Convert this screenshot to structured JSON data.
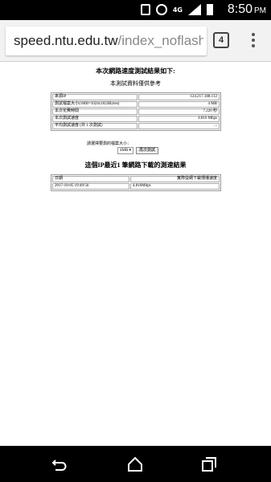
{
  "status_bar": {
    "time": "8:50",
    "ampm": "PM",
    "network": "4G"
  },
  "browser": {
    "url_domain": "speed.ntu.edu.tw",
    "url_path": "/index_noflash.p",
    "tab_count": "4"
  },
  "page": {
    "title": "本次網路速度測試結果如下:",
    "note": "本測試資料僅供參考",
    "result_table": [
      {
        "label": "來源IP",
        "value": "124.217.188.112"
      },
      {
        "label": "測試檔案大小(1MB=1024x1024Bytes)",
        "value": "4 MB"
      },
      {
        "label": "本次花費時間",
        "value": "7.220 秒"
      },
      {
        "label": "本次測試速度",
        "value": "4.816 Mbps"
      },
      {
        "label": "平均測試速度 (共 1 次測試)",
        "value": "..."
      }
    ],
    "select_prompt": "請選擇要測的檔案大小：",
    "select_value": "4MB",
    "retest_button": "再次測試",
    "history_title": "這個IP最近1 筆網路下載的測速結果",
    "history_headers": [
      "日期",
      "實際從網下載傳播速度"
    ],
    "history_rows": [
      {
        "date": "2017-10-05 19:49:56",
        "speed": "4.816Mbps"
      }
    ]
  }
}
